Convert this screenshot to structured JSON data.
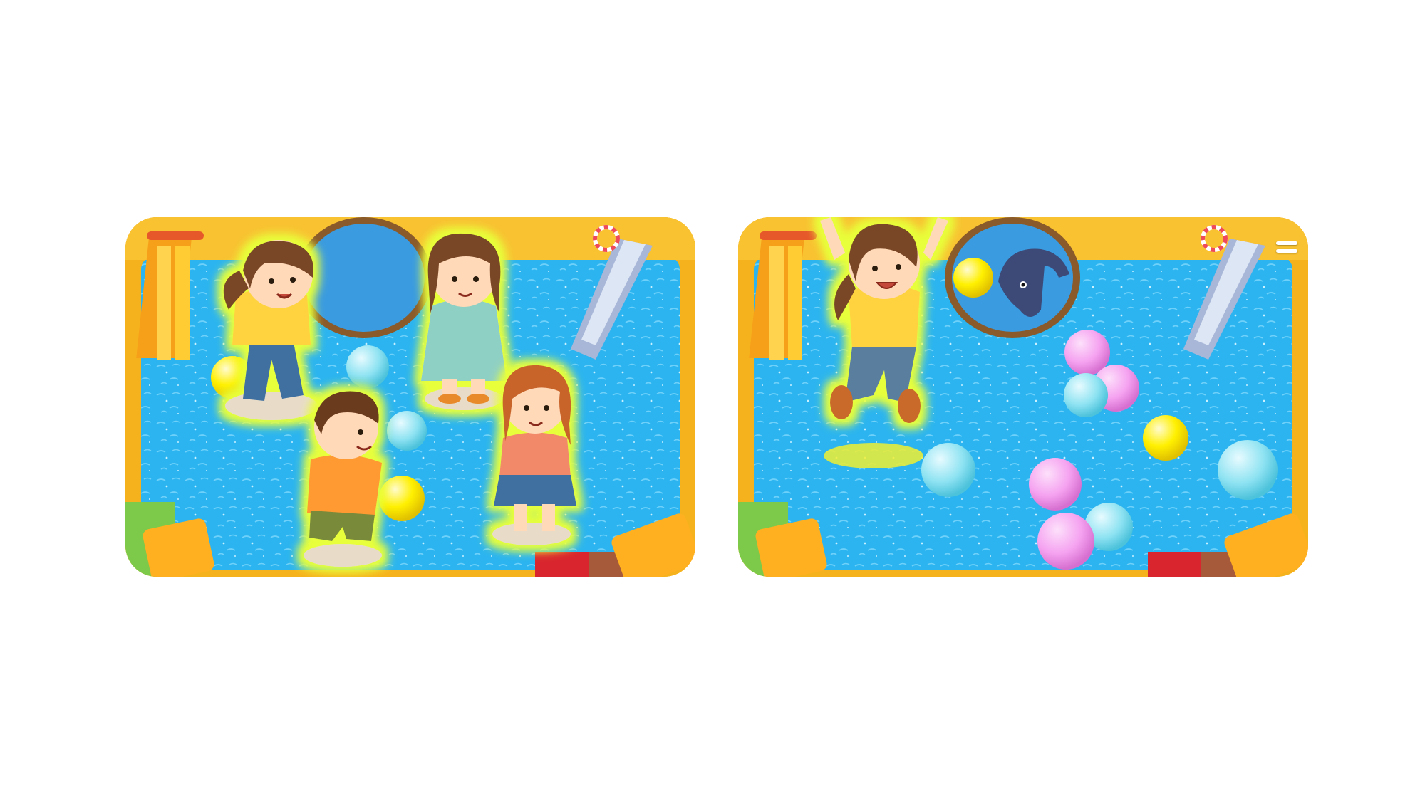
{
  "scenes": [
    {
      "id": "group-play",
      "characters": [
        "girl-ponytail-yellow-shirt",
        "girl-teal-dress",
        "boy-orange-shirt",
        "girl-coral-shirt"
      ],
      "balls": [
        {
          "color": "#8fe3f2"
        },
        {
          "color": "#fff000"
        },
        {
          "color": "#8fe3f2"
        },
        {
          "color": "#fff000"
        }
      ]
    },
    {
      "id": "jump-play",
      "characters": [
        "girl-jumping-yellow-shirt"
      ],
      "toy": "dolphin-icon",
      "menu_icon": "hamburger-menu-icon",
      "balls": [
        {
          "color": "#f5a2f0"
        },
        {
          "color": "#f5a2f0"
        },
        {
          "color": "#8fe3f2"
        },
        {
          "color": "#fff000"
        },
        {
          "color": "#f5a2f0"
        },
        {
          "color": "#8fe3f2"
        },
        {
          "color": "#8fe3f2"
        },
        {
          "color": "#f5a2f0"
        },
        {
          "color": "#8fe3f2"
        },
        {
          "color": "#fff000"
        }
      ]
    }
  ],
  "colors": {
    "pool": "#2bb4f0",
    "frame": "#f6b21c",
    "glow": "#e8ff3a",
    "ball_pink": "#f5a2f0",
    "ball_cyan": "#8fe3f2",
    "ball_yellow": "#fff000"
  }
}
